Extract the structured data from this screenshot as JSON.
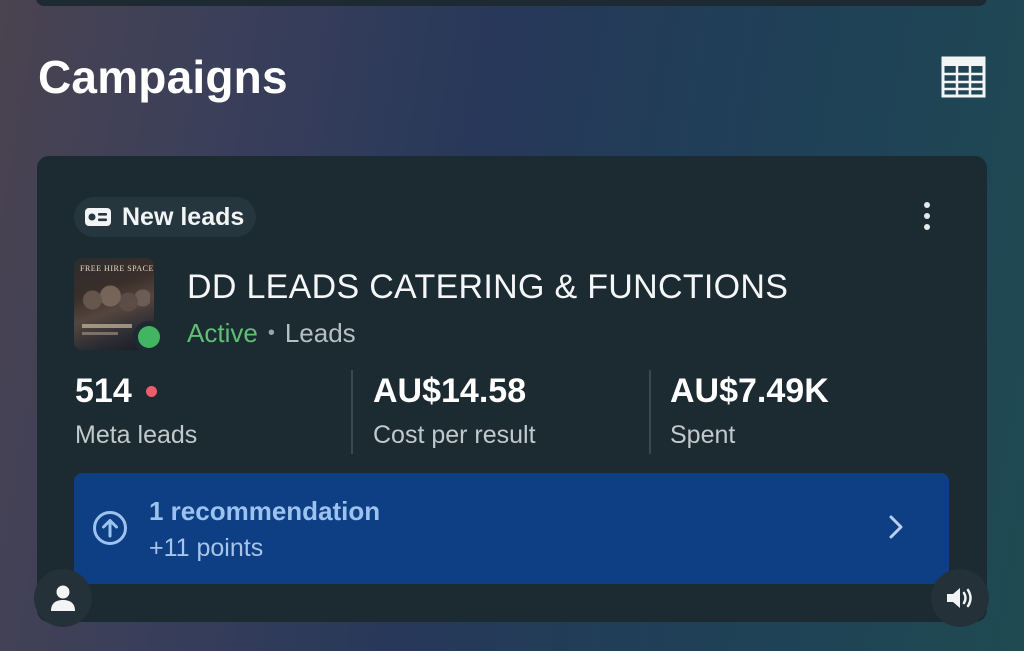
{
  "page": {
    "title": "Campaigns"
  },
  "icons": {
    "table_view": "table-icon",
    "objective": "lead-card-icon",
    "more": "more-vertical-icon",
    "recommendation": "arrow-up-circle-icon",
    "chevron": "chevron-right-icon",
    "profile": "person-icon",
    "sound": "speaker-icon"
  },
  "campaign": {
    "objective_label": "New leads",
    "thumbnail_text": "FREE HIRE SPACE",
    "name": "DD LEADS CATERING & FUNCTIONS",
    "status": "Active",
    "separator": "•",
    "type": "Leads",
    "metrics": [
      {
        "value": "514",
        "label": "Meta leads",
        "has_alert_dot": true
      },
      {
        "value": "AU$14.58",
        "label": "Cost per result"
      },
      {
        "value": "AU$7.49K",
        "label": "Spent"
      }
    ],
    "recommendation": {
      "title": "1 recommendation",
      "subtitle": "+11 points"
    }
  },
  "colors": {
    "card_bg": "#1c2a31",
    "status_active": "#5fbf74",
    "status_dot": "#43b562",
    "alert_dot": "#f05b6b",
    "recommendation_bg": "#0e3f84",
    "recommendation_text": "#9cc2ef"
  }
}
